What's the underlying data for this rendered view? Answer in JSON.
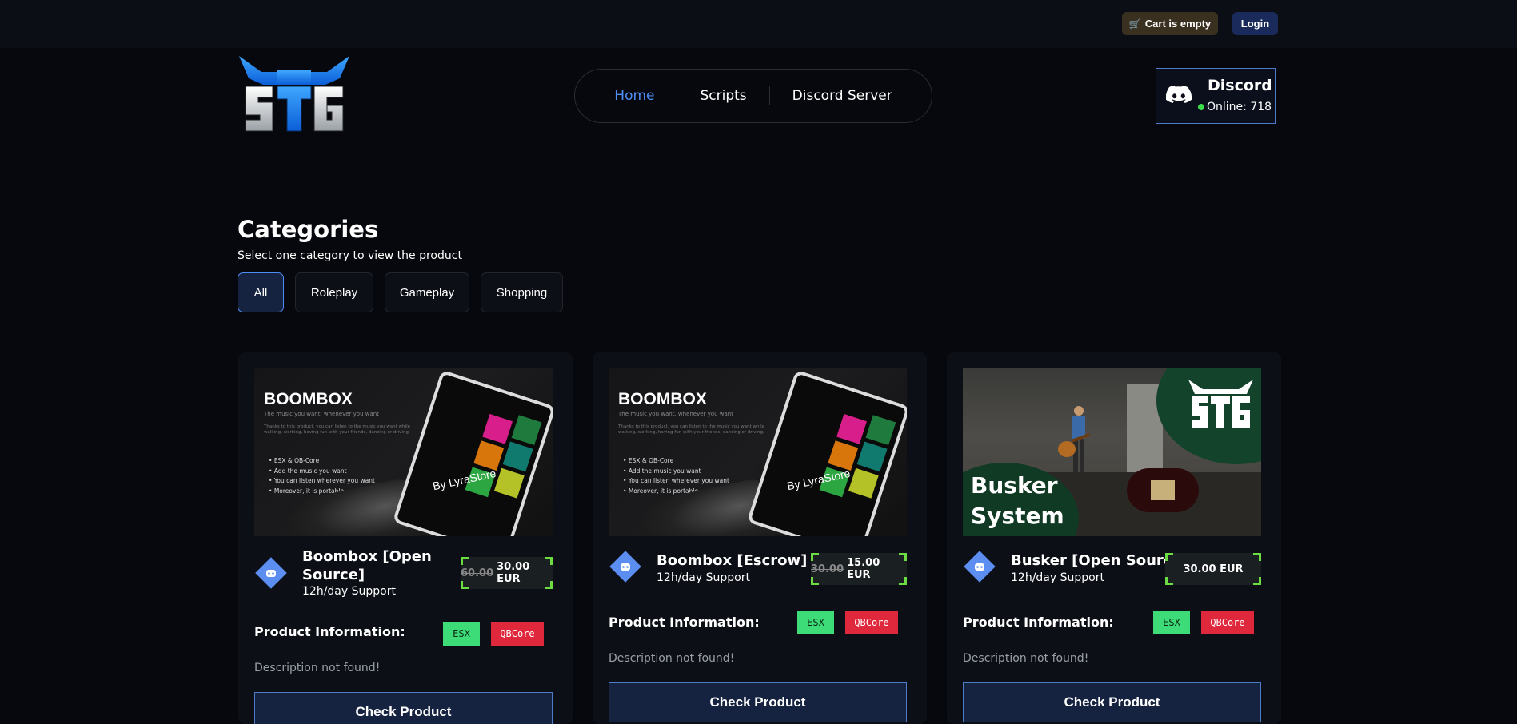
{
  "topbar": {
    "cart_label": "Cart is empty",
    "login_label": "Login"
  },
  "nav": {
    "items": [
      "Home",
      "Scripts",
      "Discord Server"
    ]
  },
  "discord": {
    "title": "Discord",
    "online": "Online: 718"
  },
  "categories": {
    "title": "Categories",
    "subtitle": "Select one category to view the product",
    "buttons": [
      "All",
      "Roleplay",
      "Gameplay",
      "Shopping"
    ]
  },
  "products": [
    {
      "name": "Boombox [Open Source]",
      "support": "12h/day Support",
      "old_price": "60.00",
      "price": "30.00 EUR",
      "info_label": "Product Information:",
      "tags": [
        "ESX",
        "QBCore"
      ],
      "description": "Description not found!",
      "button": "Check Product",
      "image": {
        "title": "BOOMBOX",
        "tagline": "The music you want, whenever you want",
        "paragraph": "Thanks to this product, you can listen to the music you want while walking, working, having fun with your friends, dancing or driving.",
        "bullets": [
          "ESX & QB-Core",
          "Add the music you want",
          "You can listen wherever you want",
          "Moreover, it is portable"
        ],
        "byline": "By LyraStore"
      }
    },
    {
      "name": "Boombox [Escrow]",
      "support": "12h/day Support",
      "old_price": "30.00",
      "price": "15.00 EUR",
      "info_label": "Product Information:",
      "tags": [
        "ESX",
        "QBCore"
      ],
      "description": "Description not found!",
      "button": "Check Product",
      "image": {
        "title": "BOOMBOX",
        "tagline": "The music you want, whenever you want",
        "paragraph": "Thanks to this product, you can listen to the music you want while walking, working, having fun with your friends, dancing or driving.",
        "bullets": [
          "ESX & QB-Core",
          "Add the music you want",
          "You can listen wherever you want",
          "Moreover, it is portable"
        ],
        "byline": "By LyraStore"
      }
    },
    {
      "name": "Busker [Open Source]",
      "support": "12h/day Support",
      "price": "30.00 EUR",
      "info_label": "Product Information:",
      "tags": [
        "ESX",
        "QBCore"
      ],
      "description": "Description not found!",
      "button": "Check Product",
      "image": {
        "line1": "Busker",
        "line2": "System"
      }
    }
  ],
  "colors": {
    "accent_blue": "#4d8ef7",
    "price_bracket": "#6ddb42",
    "esx_tag": "#3ddc78",
    "qbcore_tag": "#e0283c",
    "online_dot": "#3ddc4c"
  },
  "icons": [
    "cart-icon",
    "discord-icon",
    "discord-product-icon"
  ]
}
